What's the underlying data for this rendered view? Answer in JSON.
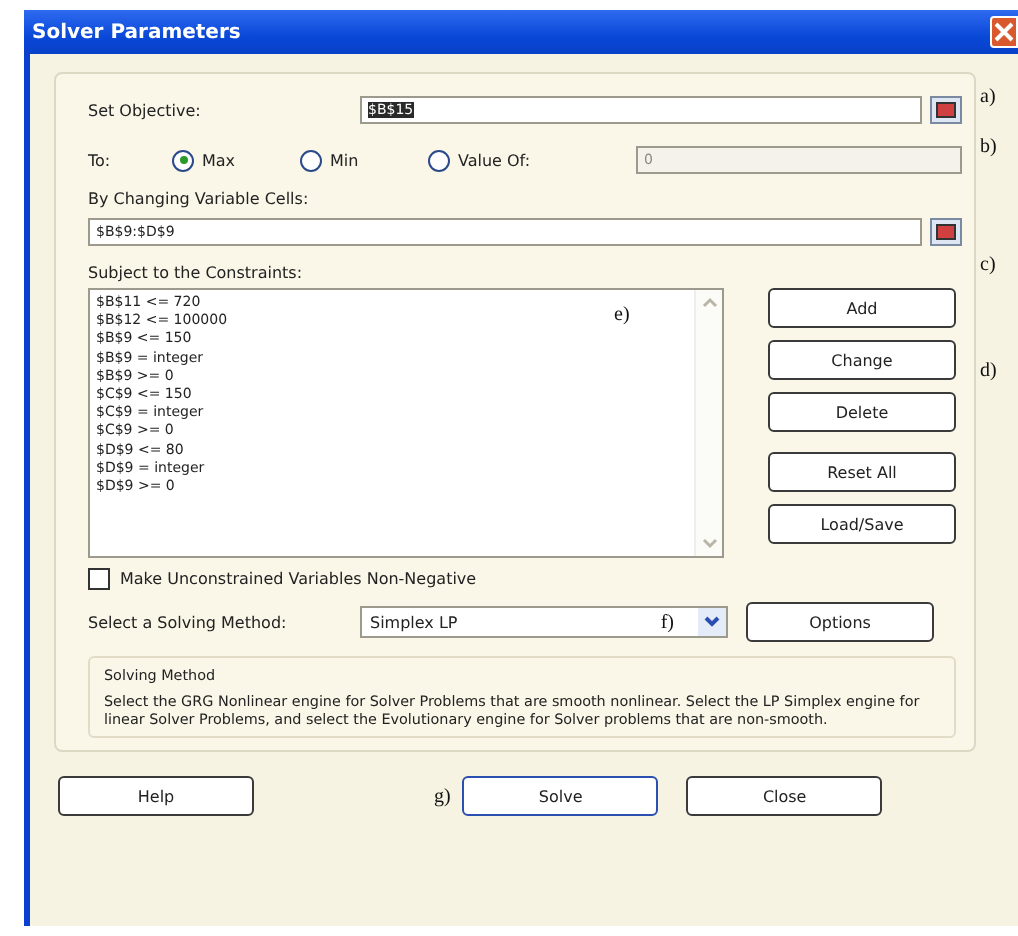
{
  "window": {
    "title": "Solver Parameters"
  },
  "objective": {
    "label": "Set Objective:",
    "value": "$B$15",
    "annotation": "a)"
  },
  "to": {
    "label": "To:",
    "options": [
      {
        "label": "Max",
        "selected": true
      },
      {
        "label": "Min",
        "selected": false
      },
      {
        "label": "Value Of:",
        "selected": false
      }
    ],
    "value": "0",
    "annotation": "b)"
  },
  "changing": {
    "label": "By Changing Variable Cells:",
    "value": "$B$9:$D$9",
    "annotation": "c)"
  },
  "constraints": {
    "label": "Subject to the Constraints:",
    "annotation": "e)",
    "buttons_annotation": "d)",
    "items": [
      "$B$11 <= 720",
      "$B$12 <= 100000",
      "$B$9 <= 150",
      "$B$9 = integer",
      "$B$9 >= 0",
      "$C$9 <= 150",
      "$C$9 = integer",
      "$C$9 >= 0",
      "$D$9 <= 80",
      "$D$9 = integer",
      "$D$9 >= 0"
    ],
    "buttons": [
      "Add",
      "Change",
      "Delete",
      "Reset All",
      "Load/Save"
    ]
  },
  "nonnegative": {
    "label": "Make Unconstrained Variables Non-Negative",
    "checked": false
  },
  "method": {
    "label": "Select a Solving Method:",
    "value": "Simplex LP",
    "annotation": "f)",
    "options_button": "Options"
  },
  "info": {
    "title": "Solving Method",
    "text": "Select the GRG Nonlinear engine for Solver Problems that are smooth nonlinear. Select the LP Simplex engine for linear Solver Problems, and select the Evolutionary engine for Solver problems that are non-smooth."
  },
  "footer": {
    "help": "Help",
    "annotation": "g)",
    "solve": "Solve",
    "close": "Close"
  }
}
